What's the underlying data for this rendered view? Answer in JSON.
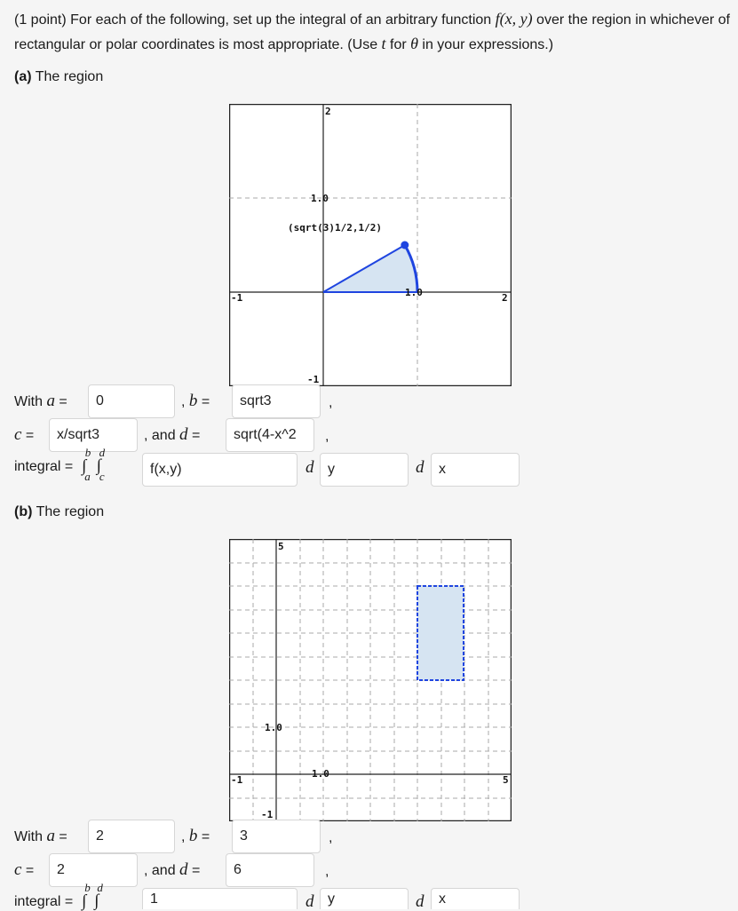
{
  "intro": {
    "prefix": "(1 point) For each of the following, set up the integral of an arbitrary function ",
    "func": "f(x, y)",
    "middle": " over the region in whichever of rectangular or polar coordinates is most appropriate. (Use ",
    "t": "t",
    "for_text": " for ",
    "theta": "θ",
    "suffix": " in your expressions.)"
  },
  "part_a": {
    "label_bold": "(a)",
    "label_text": " The region",
    "graph": {
      "x_min": -1,
      "x_max": 2,
      "y_min": -1,
      "y_max": 2,
      "tick_labels": {
        "x_neg": "-1",
        "x_pos": "2",
        "y_neg": "-1",
        "y_pos": "2",
        "x_unit": "1.0",
        "y_unit": "1.0"
      },
      "point_label": "(sqrt(3)1/2,1/2)",
      "region": "sector from angle 0 to pi/6, radius 1",
      "fill_color": "#d6e4f2",
      "edge_color": "#1f45e0"
    },
    "a_label": "With ",
    "a_var": "a",
    "eq": " = ",
    "a_value": "0",
    "b_prefix": ", ",
    "b_var": "b",
    "b_value": "sqrt3",
    "comma": ",",
    "c_var": "c",
    "c_value": "x/sqrt3",
    "d_prefix": ", and ",
    "d_var": "d",
    "d_value": "sqrt(4-x^2",
    "integral_label": "integral = ",
    "integrand_value": "f(x,y)",
    "d1_var": "d",
    "d1_value": "y",
    "d2_var": "d",
    "d2_value": "x"
  },
  "part_b": {
    "label_bold": "(b)",
    "label_text": " The region",
    "graph": {
      "x_min": -1,
      "x_max": 5,
      "y_min": -1,
      "y_max": 5,
      "tick_labels": {
        "x_neg": "-1",
        "x_pos": "5",
        "y_neg": "-1",
        "y_pos": "5",
        "x_unit": "1.0",
        "y_unit": "1.0"
      },
      "region": "rectangle 3<=x<=4, 2<=y<=4",
      "fill_color": "#d6e4f2",
      "edge_color": "#1f45e0"
    },
    "a_label": "With ",
    "a_var": "a",
    "eq": " = ",
    "a_value": "2",
    "b_prefix": ", ",
    "b_var": "b",
    "b_value": "3",
    "comma": ",",
    "c_var": "c",
    "c_value": "2",
    "d_prefix": ", and ",
    "d_var": "d",
    "d_value": "6",
    "integral_label": "integral = ",
    "integrand_value": "1",
    "d1_var": "d",
    "d1_value": "y",
    "d2_var": "d",
    "d2_value": "x"
  }
}
